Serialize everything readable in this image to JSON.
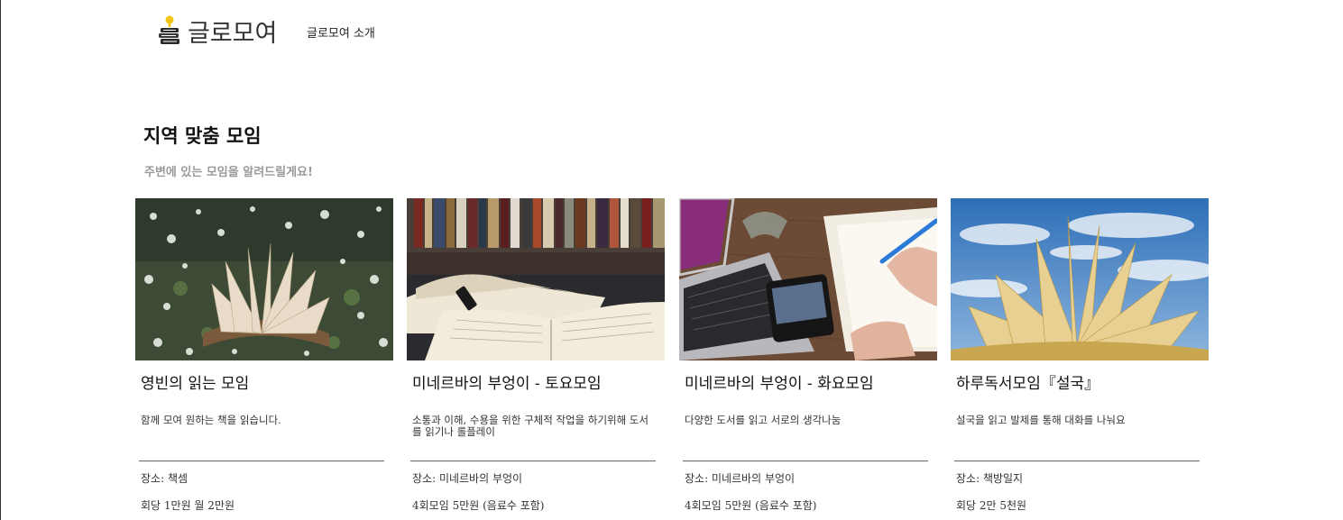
{
  "header": {
    "logo_text": "글로모여",
    "nav_about": "글로모여 소개"
  },
  "section": {
    "title": "지역 맞춤 모임",
    "subtitle": "주변에 있는 모임을 알려드릴게요!"
  },
  "cards": [
    {
      "image": "book-among-blossoms",
      "title": "영빈의 읽는 모임",
      "description": "함께 모여 원하는 책을 읽습니다.",
      "place": "장소: 책셈",
      "fee": "회당 1만원 월 2만원"
    },
    {
      "image": "open-books-bookshelf",
      "title": "미네르바의 부엉이 - 토요모임",
      "description": "소통과 이해, 수용을 위한 구체적 작업을 하기위해 도서를 읽기나 롤플레이",
      "place": "장소: 미네르바의 부엉이",
      "fee": "4회모임 5만원 (음료수 포함)"
    },
    {
      "image": "laptop-phone-notebook",
      "title": "미네르바의 부엉이 - 화요모임",
      "description": "다양한 도서를 읽고 서로의 생각나눔",
      "place": "장소: 미네르바의 부엉이",
      "fee": "4회모임 5만원 (음료수 포함)"
    },
    {
      "image": "book-pages-sky",
      "title": "하루독서모임『설국』",
      "description": "설국을 읽고 발제를 통해 대화를 나눠요",
      "place": "장소: 책방일지",
      "fee": "회당 2만 5천원"
    }
  ]
}
